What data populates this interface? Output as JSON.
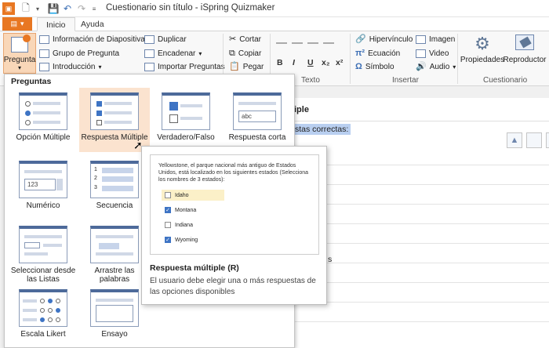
{
  "window": {
    "title": "Cuestionario sin título - iSpring Quizmaker"
  },
  "tabs": {
    "file_icon": "menu-icon",
    "inicio": "Inicio",
    "ayuda": "Ayuda"
  },
  "ribbon": {
    "pregunta_label": "Pregunta",
    "slide_group": [
      "Información de Diapositiva",
      "Grupo de Pregunta",
      "Introducción"
    ],
    "insert_group": [
      "Duplicar",
      "Encadenar",
      "Importar Preguntas"
    ],
    "clipboard": [
      "Cortar",
      "Copiar",
      "Pegar"
    ],
    "text_label": "Texto",
    "insertar": [
      "Hipervínculo",
      "Ecuación",
      "Símbolo"
    ],
    "media": [
      "Imagen",
      "Video",
      "Audio"
    ],
    "insertar_label": "Insertar",
    "props": "Propiedades",
    "player": "Reproductor",
    "cuestionario_label": "Cuestionario"
  },
  "document": {
    "heading_fragment": "iple",
    "text_fragment": "stas correctas:",
    "side_fragment": "s"
  },
  "gallery": {
    "title": "Preguntas",
    "items": [
      "Opción Múltiple",
      "Respuesta Múltiple",
      "Verdadero/Falso",
      "Respuesta corta",
      "Numérico",
      "Secuencia",
      "Seleccionar desde las Listas",
      "Arrastre las palabras",
      "Escala Likert",
      "Ensayo"
    ],
    "thumb_texts": {
      "numeric": "123",
      "short": "abc",
      "sequence": [
        "1",
        "2",
        "3"
      ]
    }
  },
  "tooltip": {
    "question": "Yellowstone, el parque nacional más antiguo de Estados Unidos, está localizado en los siguientes estados (Selecciona los nombres de 3 estados):",
    "options": [
      {
        "label": "Idaho",
        "checked": false
      },
      {
        "label": "Montana",
        "checked": true
      },
      {
        "label": "Indiana",
        "checked": false
      },
      {
        "label": "Wyoming",
        "checked": true
      }
    ],
    "title": "Respuesta múltiple (R)",
    "description": "El usuario debe elegir una o más respuestas de las opciones disponibles"
  },
  "colors": {
    "accent": "#e87722",
    "selection": "#fbe3cf",
    "check": "#3e74c4"
  }
}
